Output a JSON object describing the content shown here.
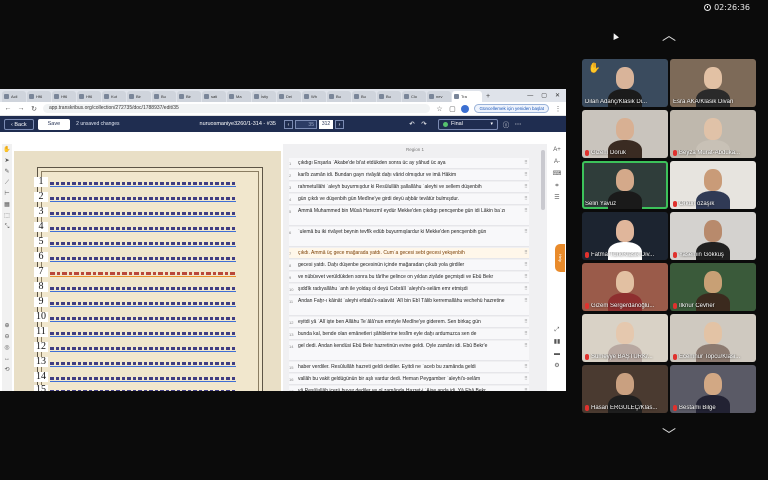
{
  "timer": "02:26:36",
  "browser": {
    "tabs": [
      "Acil",
      "Hf6",
      "Hf6",
      "Hf6",
      "Kut",
      "Bir",
      "Bu",
      "Bir",
      "sati",
      "Ma",
      "İstiy",
      "Dei",
      "Wh",
      "Bu",
      "Bu",
      "Bu",
      "Clo",
      "nev",
      "Tra"
    ],
    "url": "app.transkribus.org/collection/272735/doc/1788937/edit/35",
    "update_label": "Güncellemek için yeniden başlat"
  },
  "app": {
    "back_label": "Back",
    "save_label": "Save",
    "unsaved": "2 unsaved changes",
    "doc_name": "nuruosmaniye3260/1-314 - #35",
    "page_current": "35",
    "page_total": "312",
    "status": "Final"
  },
  "region_label": "Region 1",
  "transcription": [
    {
      "no": "1",
      "text": "çıkdıgı Enşarla `Akabe'de bi'at etdükden sonra üc ay yâhud üc aya"
    },
    {
      "no": "2",
      "text": "karîb zamân idi. Bundan gayrı rivâyât daḫı vârid olmışdur ve imâ Hâkim"
    },
    {
      "no": "3",
      "text": "rahmetullâhi `aleyh buyurmışdur ki Resûlullâh şallallâhu `aleyhi ve sellem düşenbih"
    },
    {
      "no": "4",
      "text": "gün çıkdı ve düşenbih gün Medîne'ye girdi deyü aḫbâr tevâtür bulmışdur."
    },
    {
      "no": "5",
      "text": "Ammâ Muhammed bin Mûsâ Harezmî eydür Mekke'den çıkdıgı pencşenbe gün idi Lâkin ba`zı"
    },
    {
      "no": "6",
      "text": "`ulemâ bu iki rivâyet beynin tevfîk edüb buyurmışlardur ki Mekke'den pencşenbih gün"
    },
    {
      "no": "7",
      "text": "çıkdı. Ammâ üç gece mağarada yatdı. Cum`a gecesi sebt gecesi yekşenbih"
    },
    {
      "no": "8",
      "text": "gecesi yatdı. Daḫı düşenbe gecesinün içinde mağaradan çıkub yola girdiler"
    },
    {
      "no": "9",
      "text": "ve nübüvvet verüldükden sonra bu târîhe gelince on yıldan ziyâde geçmişdi ve Ebû Bekr"
    },
    {
      "no": "10",
      "text": "şıddîk radıyallâhu `anh ile yoldaş ol deyü Cebrâîl `aleyhi's-selâm emr etmişdi"
    },
    {
      "no": "11",
      "text": "Andan Faḫr-ı kâinât `aleyhi efdalü's-salavât `Alî bin Ebî Tâlib kerremallâhu vechehü hazretine"
    },
    {
      "no": "12",
      "text": "eyitdi yâ `Alî işte ben Allâhu Te`âlâ'nun emriyle Medîne'ye giderem. Sen birkaç gün"
    },
    {
      "no": "13",
      "text": "bunda kal, bende olan emânetleri şâhiblerine teslîm eyle daḫı ardumuzca sen de"
    },
    {
      "no": "14",
      "text": "gel dedi. Andan kendüsi Ebû Bekr hazretinün evine geldi. Öyle zamânı idi. Ebû Bekr'e"
    },
    {
      "no": "15",
      "text": "haber verdiler. Resûlullâh hazreti geldi dediler. Eyitdi ne `aceb bu zamânda geldi"
    },
    {
      "no": "16",
      "text": "vallâh bu vakit geldügünün bir aşlı vardur dedi. Heman Peygamber `aleyhi's-selâm"
    },
    {
      "no": "17",
      "text": "yâ Resûlullâh içerü buyur dediler ve ol zamânda Hazret-i `Âişe anda idi. Yâ Ebâ Bekr"
    }
  ],
  "participants": [
    {
      "name": "Dilan Adanç/Klasik Di...",
      "muted": false,
      "raised_hand": true
    },
    {
      "name": "Esra AKA/Klasik Divan",
      "muted": false,
      "raised_hand": false
    },
    {
      "name": "Gizem Doruk",
      "muted": true,
      "raised_hand": false
    },
    {
      "name": "Beyza Murat-Abduka...",
      "muted": true,
      "raised_hand": false
    },
    {
      "name": "Selin Yavuz",
      "muted": false,
      "raised_hand": false
    },
    {
      "name": "Orkun özaşık",
      "muted": true,
      "raised_hand": false
    },
    {
      "name": "Fatma Türk/Klasik Div...",
      "muted": true,
      "raised_hand": false
    },
    {
      "name": "Yasemin Gökkuş",
      "muted": true,
      "raised_hand": false
    },
    {
      "name": "Gizem Sergerdanoğlu...",
      "muted": true,
      "raised_hand": false
    },
    {
      "name": "İlknur Cevher",
      "muted": true,
      "raised_hand": false
    },
    {
      "name": "Sümeyye BAŞTÜRK/...",
      "muted": true,
      "raised_hand": false
    },
    {
      "name": "Ecemnur Topcu/Klasi...",
      "muted": true,
      "raised_hand": false
    },
    {
      "name": "Hasan ERGÜLEÇ/Klas...",
      "muted": true,
      "raised_hand": false
    },
    {
      "name": "Bestami Bilge",
      "muted": true,
      "raised_hand": false
    }
  ],
  "colors": {
    "app_header": "#1f2d50",
    "active_speaker": "#3cc25a",
    "muted_mic": "#e0322e"
  }
}
